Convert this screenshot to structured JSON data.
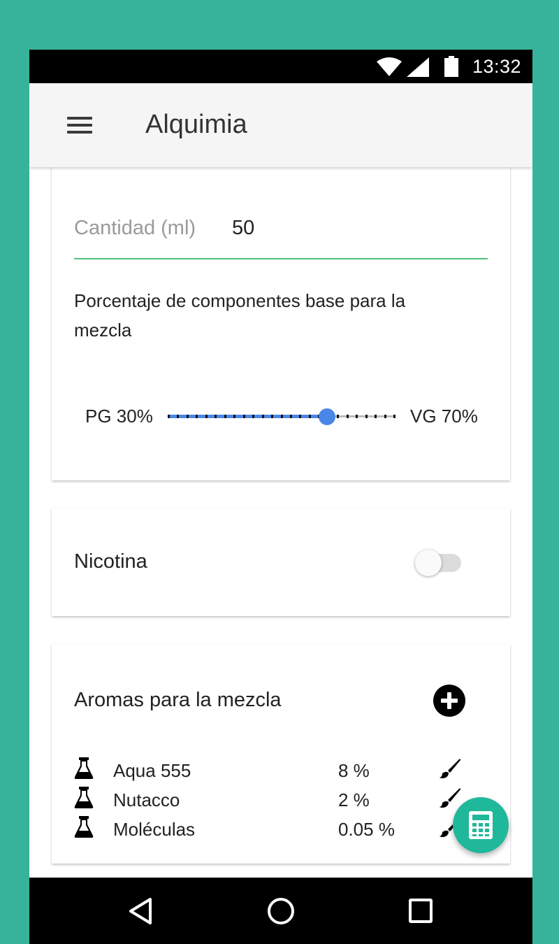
{
  "status_bar": {
    "time": "13:32"
  },
  "app_bar": {
    "title": "Alquimia"
  },
  "quantity": {
    "label": "Cantidad (ml)",
    "value": "50"
  },
  "base_mix": {
    "description": "Porcentaje de componentes base para la mezcla",
    "pg_label": "PG 30%",
    "vg_label": "VG 70%",
    "vg_fraction": 0.7
  },
  "nicotine": {
    "label": "Nicotina",
    "enabled": false
  },
  "aromas": {
    "title": "Aromas para la mezcla",
    "items": [
      {
        "name": "Aqua 555",
        "percent": "8 %"
      },
      {
        "name": "Nutacco",
        "percent": "2 %"
      },
      {
        "name": "Moléculas",
        "percent": "0.05 %"
      }
    ]
  },
  "colors": {
    "background": "#36b39a",
    "accent_green": "#4dc27a",
    "slider_blue": "#4a86e8",
    "fab": "#1fb89a"
  },
  "icons": {
    "menu": "menu-icon",
    "add": "add-circle-icon",
    "flask": "flask-icon",
    "edit": "brush-icon",
    "fab": "calculator-icon"
  }
}
